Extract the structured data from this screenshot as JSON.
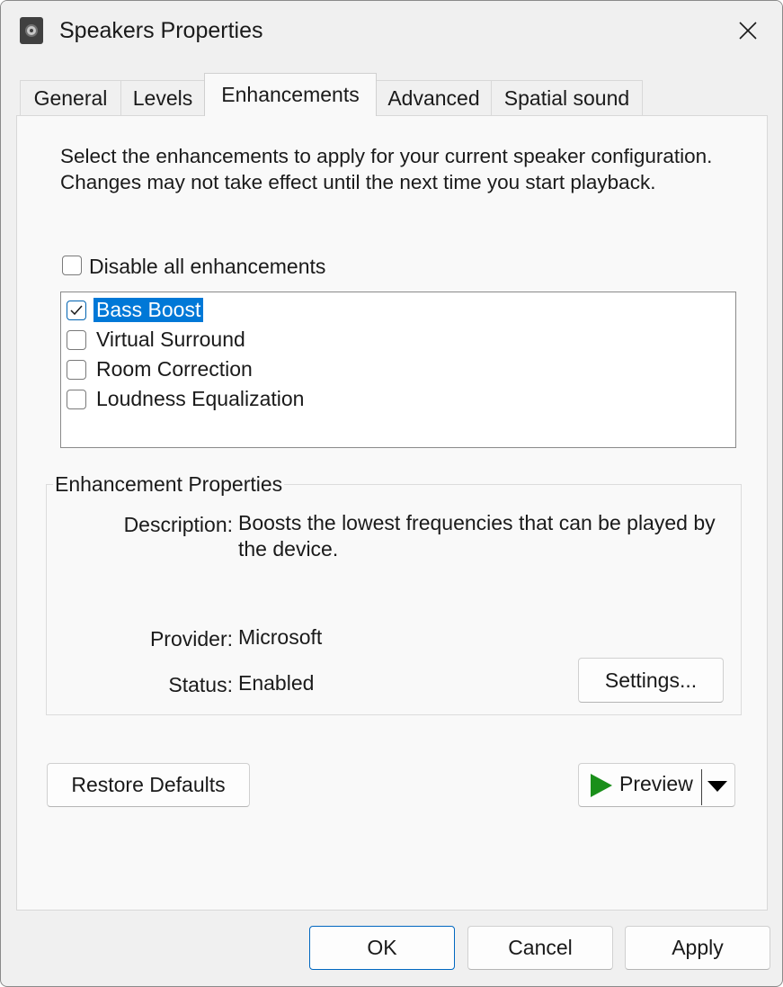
{
  "window": {
    "title": "Speakers Properties",
    "app_icon": "speaker-icon",
    "close_icon": "close-icon"
  },
  "tabs": [
    {
      "label": "General",
      "active": false
    },
    {
      "label": "Levels",
      "active": false
    },
    {
      "label": "Enhancements",
      "active": true
    },
    {
      "label": "Advanced",
      "active": false
    },
    {
      "label": "Spatial sound",
      "active": false
    }
  ],
  "enhancements": {
    "intro_text": "Select the enhancements to apply for your current speaker configuration. Changes may not take effect until the next time you start playback.",
    "disable_all": {
      "label": "Disable all enhancements",
      "checked": false
    },
    "items": [
      {
        "label": "Bass Boost",
        "checked": true,
        "selected": true
      },
      {
        "label": "Virtual Surround",
        "checked": false,
        "selected": false
      },
      {
        "label": "Room Correction",
        "checked": false,
        "selected": false
      },
      {
        "label": "Loudness Equalization",
        "checked": false,
        "selected": false
      }
    ]
  },
  "properties": {
    "group_title": "Enhancement Properties",
    "description_label": "Description:",
    "description_value": "Boosts the lowest frequencies that can be played by the device.",
    "provider_label": "Provider:",
    "provider_value": "Microsoft",
    "status_label": "Status:",
    "status_value": "Enabled",
    "settings_button": "Settings..."
  },
  "actions": {
    "restore_defaults": "Restore Defaults",
    "preview": "Preview",
    "preview_icon": "play-icon",
    "dropdown_icon": "triangle-down-icon"
  },
  "footer": {
    "ok": "OK",
    "cancel": "Cancel",
    "apply": "Apply"
  },
  "colors": {
    "selection": "#0078d7",
    "default_button_border": "#0067c0",
    "play_green": "#1a8f1a"
  }
}
